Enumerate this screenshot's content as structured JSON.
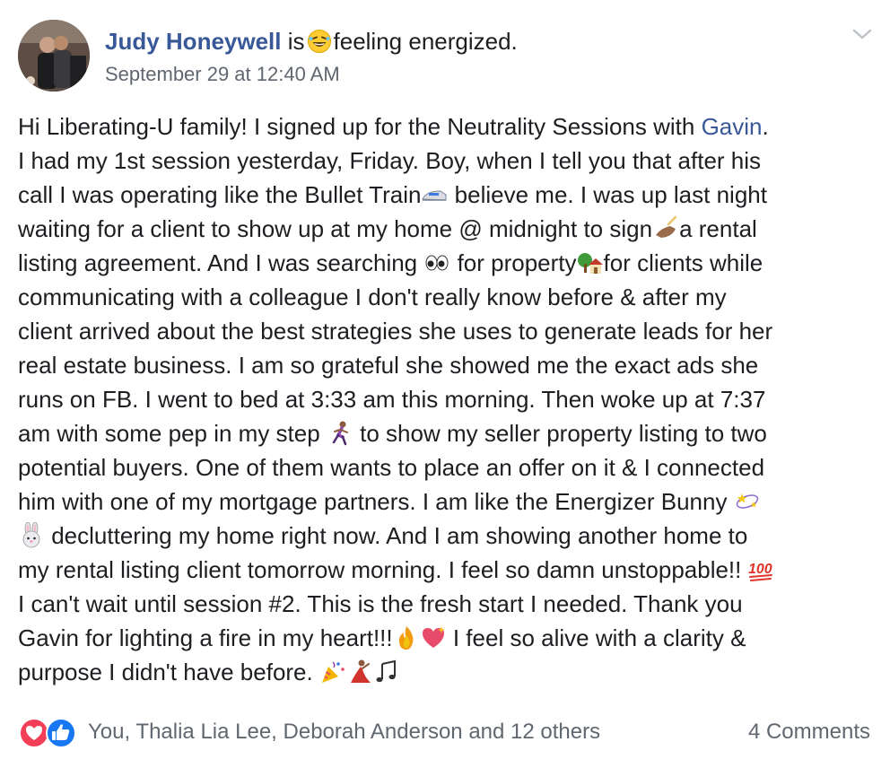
{
  "post": {
    "author": "Judy Honeywell",
    "is_text": "is",
    "feeling": "feeling energized.",
    "feeling_icon": "laughing-face-icon",
    "timestamp": "September 29 at 12:40 AM",
    "menu_icon": "chevron-down-icon"
  },
  "body": {
    "l1a": "Hi Liberating-U family! I signed up for the Neutrality Sessions with ",
    "l1_link": "Gavin",
    "l1b": ".",
    "l2": "I had my 1st session yesterday, Friday. Boy, when I tell you that after his",
    "l3a": "call I was operating like the Bullet Train",
    "l3b": " believe me. I was up last night",
    "l4": "waiting for a client to show up at my home @ midnight to sign",
    "l4b": "a rental",
    "l5a": "listing agreement. And I was searching ",
    "l5b": " for property",
    "l5c": "for clients while",
    "l6": "communicating with a colleague I don't really know before & after my",
    "l7": "client arrived about the best strategies she uses to generate leads for her",
    "l8": "real estate business. I am so grateful she showed me the exact ads she",
    "l9": "runs on FB. I went to bed at 3:33 am this morning. Then woke up at 7:37",
    "l10a": "am with some pep in my step ",
    "l10b": " to show my seller property listing to two",
    "l11": "potential buyers. One of them wants to place an offer on it & I connected",
    "l12": "him with one of my mortgage partners. I am like the Energizer Bunny ",
    "l13": " decluttering my home right now. And I am showing another home to",
    "l14": "my rental listing client tomorrow morning. I feel so damn unstoppable!! ",
    "l15": "I can't wait until session #2. This is the fresh start I needed. Thank you",
    "l16": "Gavin for lighting a fire in my heart!!!",
    "l16b": " I feel so alive with a clarity &",
    "l17": "purpose I didn't have before. "
  },
  "emojis": [
    "train-icon",
    "writing-hand-icon",
    "eyes-icon",
    "house-icon",
    "running-woman-icon",
    "dizzy-icon",
    "rabbit-icon",
    "hundred-points-icon",
    "fire-icon",
    "sparkling-heart-icon",
    "party-popper-icon",
    "dancer-icon",
    "music-notes-icon"
  ],
  "footer": {
    "reactions": [
      "love-reaction-icon",
      "like-reaction-icon"
    ],
    "names": "You, Thalia Lia Lee, Deborah Anderson and 12 others",
    "comments": "4 Comments"
  },
  "colors": {
    "link": "#385898",
    "text": "#1c1e21",
    "meta": "#606770",
    "love": "#f33e58",
    "like": "#1877f2"
  }
}
